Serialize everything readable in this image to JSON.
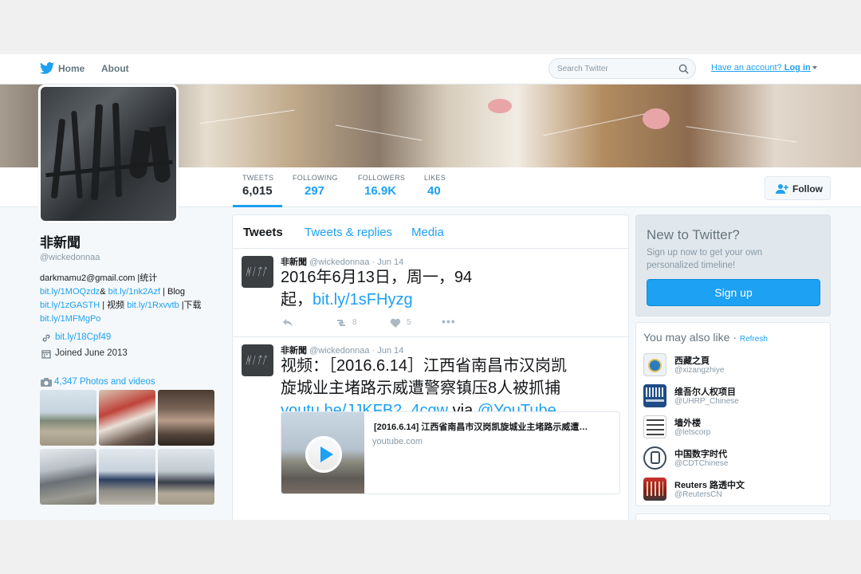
{
  "nav": {
    "home": "Home",
    "about": "About"
  },
  "search": {
    "placeholder": "Search Twitter"
  },
  "login": {
    "prefix": "Have an account?",
    "link": "Log in"
  },
  "profile": {
    "name": "非新聞",
    "handle": "@wickedonnaa",
    "bio": {
      "line1": "darkmamu2@gmail.com |统计",
      "l2a": "bit.ly/1MOQzdz",
      "l2b": "&",
      "l2c": "bit.ly/1nk2Azf",
      "l2d": " | Blog",
      "l3a": "bit.ly/1zGASTH",
      "l3b": " | 视频 ",
      "l3c": "bit.ly/1Rxvvtb",
      "l3d": " |下载",
      "l4": "bit.ly/1MFMgPo"
    },
    "link": "bit.ly/18Cpf49",
    "joined": "Joined June 2013",
    "photos_label": "4,347 Photos and videos"
  },
  "stats": [
    {
      "label": "TWEETS",
      "value": "6,015"
    },
    {
      "label": "FOLLOWING",
      "value": "297"
    },
    {
      "label": "FOLLOWERS",
      "value": "16.9K"
    },
    {
      "label": "LIKES",
      "value": "40"
    }
  ],
  "follow_label": "Follow",
  "tabs": [
    "Tweets",
    "Tweets & replies",
    "Media"
  ],
  "tweets": [
    {
      "name": "非新聞",
      "handle": "@wickedonnaa · Jun 14",
      "text1": "2016年6月13日，周一，94",
      "text2": "起，",
      "link": "bit.ly/1sFHyzg",
      "retweets": "8",
      "likes": "5"
    },
    {
      "name": "非新聞",
      "handle": "@wickedonnaa · Jun 14",
      "text1": "视频：［2016.6.14］江西省南昌市汉岗凯",
      "text2": "旋城业主堵路示威遭警察镇压8人被抓捕",
      "link1": "youtu.be/JJKFB2_4cgw",
      "via": " via ",
      "link2": "@YouTube",
      "card_title": "[2016.6.14] 江西省南昌市汉岗凯旋城业主堵路示威遭…",
      "card_url": "youtube.com"
    }
  ],
  "signup": {
    "title": "New to Twitter?",
    "desc": "Sign up now to get your own personalized timeline!",
    "button": "Sign up"
  },
  "wtf": {
    "title": "You may also like",
    "sep": " · ",
    "refresh": "Refresh",
    "items": [
      {
        "name": "西藏之頁",
        "handle": "@xizangzhiye"
      },
      {
        "name": "维吾尔人权项目",
        "handle": "@UHRP_Chinese"
      },
      {
        "name": "墙外楼",
        "handle": "@letscorp"
      },
      {
        "name": "中国数字时代",
        "handle": "@CDTChinese"
      },
      {
        "name": "Reuters 路透中文",
        "handle": "@ReutersCN"
      }
    ]
  },
  "colors": {
    "accent": "#1da1f2",
    "text": "#14171a",
    "muted": "#8899a6"
  }
}
